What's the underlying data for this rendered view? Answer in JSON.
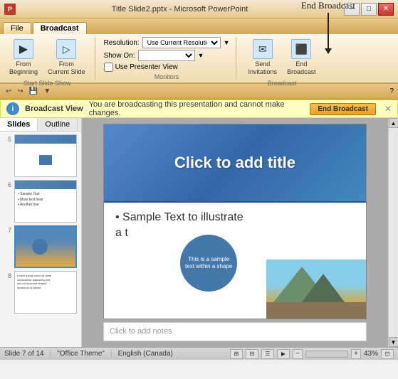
{
  "titlebar": {
    "icon": "P",
    "title": "Title Slide2.pptx - Microsoft PowerPoint",
    "min_btn": "─",
    "max_btn": "□",
    "close_btn": "✕"
  },
  "tabs": [
    {
      "id": "file",
      "label": "File"
    },
    {
      "id": "broadcast",
      "label": "Broadcast"
    }
  ],
  "ribbon": {
    "groups": [
      {
        "id": "start-slide-show",
        "label": "Start Slide Show",
        "buttons": [
          {
            "id": "from-beginning",
            "icon": "▶",
            "label": "From\nBeginning"
          },
          {
            "id": "from-current",
            "icon": "▷",
            "label": "From\nCurrent Slide"
          }
        ]
      },
      {
        "id": "monitors",
        "label": "Monitors",
        "resolution_label": "Resolution:",
        "resolution_value": "Use Current Resolution",
        "show_on_label": "Show On:",
        "show_on_value": "",
        "presenter_view_label": "Use Presenter View"
      },
      {
        "id": "broadcast",
        "label": "Broadcast",
        "buttons": [
          {
            "id": "send-invitations",
            "icon": "✉",
            "label": "Send\nInvitations"
          },
          {
            "id": "end-broadcast",
            "icon": "⬛",
            "label": "End\nBroadcast"
          }
        ]
      }
    ]
  },
  "quick_access": {
    "buttons": [
      "↩",
      "↪",
      "💾",
      "▼"
    ]
  },
  "broadcast_bar": {
    "icon": "i",
    "label": "Broadcast View",
    "message": "You are broadcasting this presentation and cannot make changes.",
    "end_btn": "End Broadcast",
    "close_btn": "✕"
  },
  "sidebar": {
    "tabs": [
      {
        "id": "slides",
        "label": "Slides",
        "active": true
      },
      {
        "id": "outline",
        "label": "Outline"
      }
    ],
    "close_label": "✕",
    "slides": [
      {
        "num": "5",
        "type": "blue-box"
      },
      {
        "num": "6",
        "type": "text-lines"
      },
      {
        "num": "7",
        "type": "gradient",
        "selected": true
      },
      {
        "num": "8",
        "type": "text-dense"
      }
    ]
  },
  "slide": {
    "title": "Click to add title",
    "bullet_text": "• Sample Text to illustrate",
    "bullet_cont": "a            t",
    "circle_text": "This is a sample text within a shape",
    "notes_placeholder": "Click to add notes"
  },
  "status_bar": {
    "slide_info": "Slide 7 of 14",
    "theme": "\"Office Theme\"",
    "language": "English (Canada)",
    "zoom": "43%"
  },
  "annotation": {
    "label": "End Broadcast"
  }
}
